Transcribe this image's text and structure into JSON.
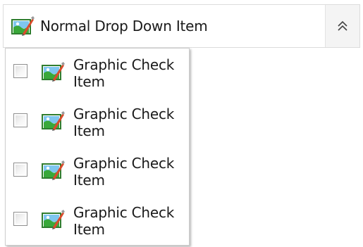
{
  "dropdown": {
    "selected_label": "Normal Drop Down Item",
    "selected_icon": "image-edit-icon",
    "toggle_icon": "chevrons-up-icon"
  },
  "panel": {
    "items": [
      {
        "label": "Graphic Check Item",
        "checked": false,
        "icon": "image-edit-icon"
      },
      {
        "label": "Graphic Check Item",
        "checked": false,
        "icon": "image-edit-icon"
      },
      {
        "label": "Graphic Check Item",
        "checked": false,
        "icon": "image-edit-icon"
      },
      {
        "label": "Graphic Check Item",
        "checked": false,
        "icon": "image-edit-icon"
      }
    ]
  }
}
